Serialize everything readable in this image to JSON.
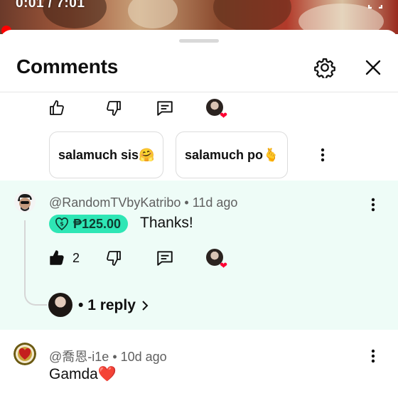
{
  "video": {
    "time": "0:01 / 7:01",
    "progress_fraction": 0.0024
  },
  "comments_panel": {
    "title": "Comments"
  },
  "icons": {
    "like": "thumb-up-icon",
    "dislike": "thumb-down-icon",
    "reply": "comment-icon",
    "settings": "gear-icon",
    "close": "close-icon",
    "more": "more-vertical-icon",
    "chevron": "chevron-right-icon"
  },
  "colors": {
    "accent_red": "#ff0000",
    "thanks_green": "#2ee6b5",
    "highlight_bg": "#eefcf7",
    "heart_red": "#ff0033"
  },
  "suggested_replies": [
    {
      "label": "salamuch sis🤗"
    },
    {
      "label": "salamuch po🫰"
    }
  ],
  "comments": [
    {
      "author": "@RandomTVbyKatribo",
      "age": "11d ago",
      "thanks_amount": "₱125.00",
      "text": "Thanks!",
      "like_count": "2",
      "replies_label": "1 reply"
    },
    {
      "author": "@喬恩-i1e",
      "age": "10d ago",
      "text": "Gamda❤️"
    }
  ]
}
